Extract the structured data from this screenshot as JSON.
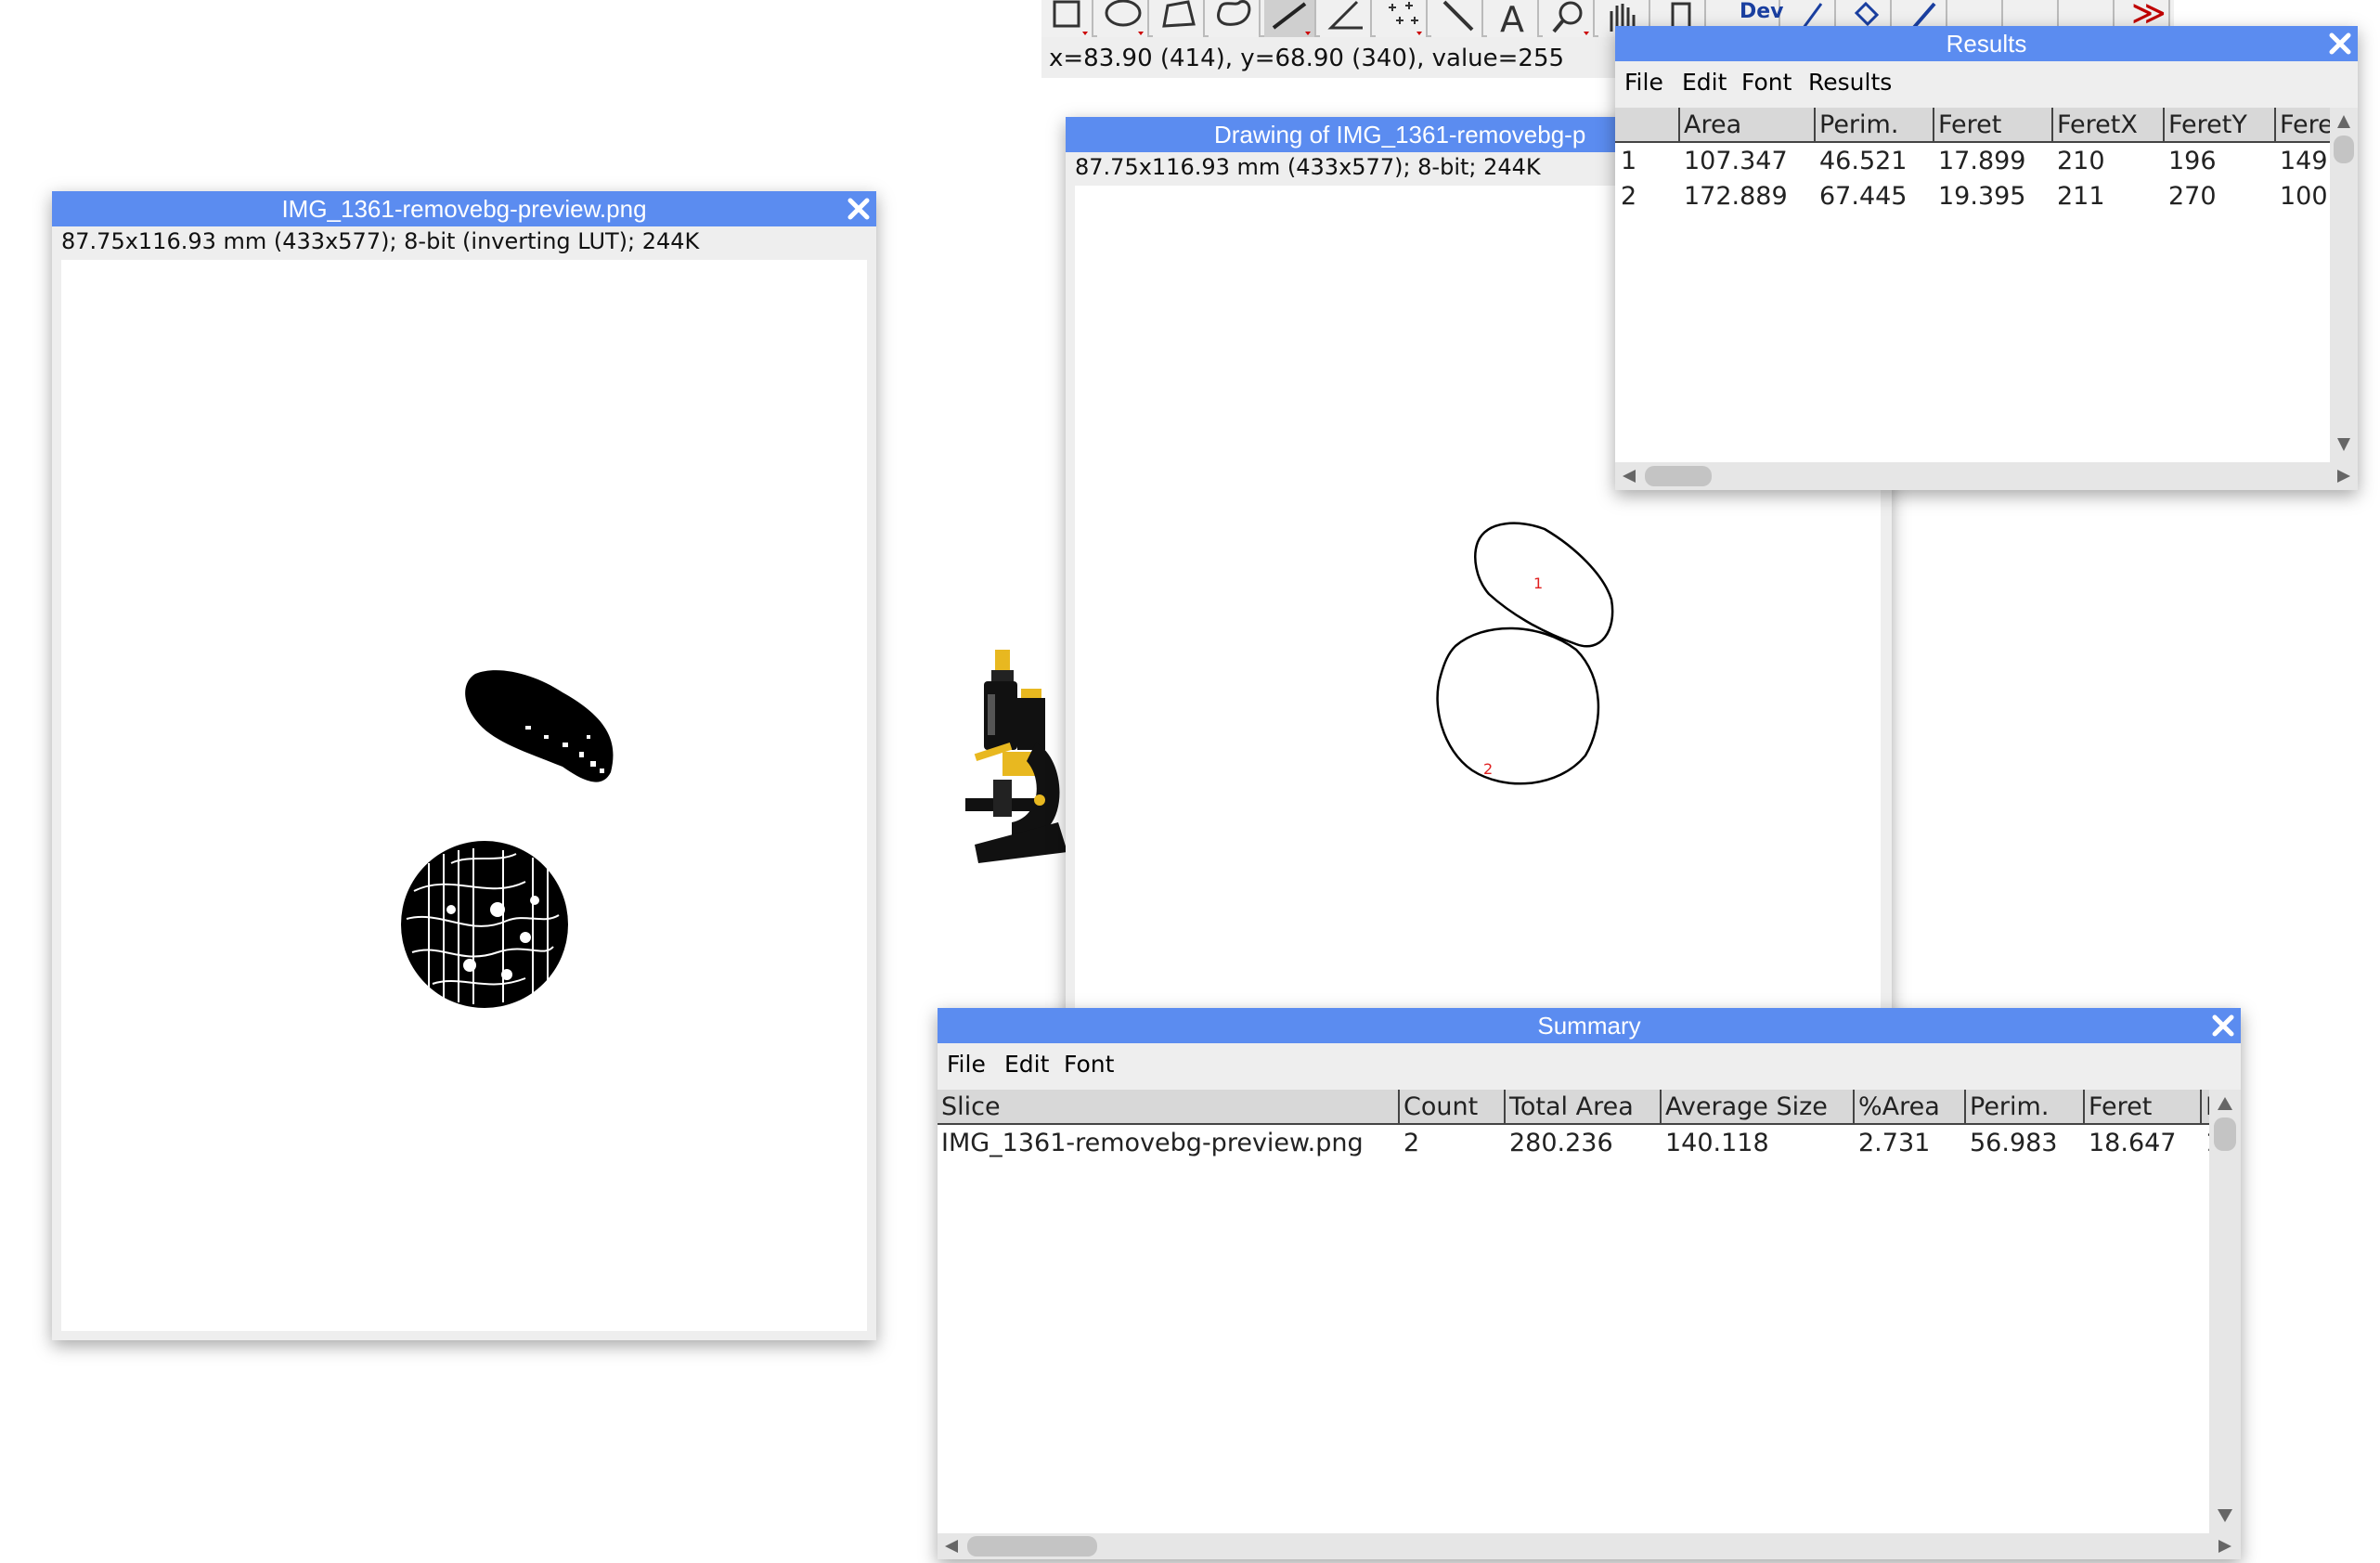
{
  "toolbar": {
    "coords": "x=83.90 (414), y=68.90 (340), value=255",
    "dev_label": "Dev",
    "more_label": "≫",
    "tools": [
      "rectangle-icon",
      "oval-icon",
      "polygon-icon",
      "freehand-icon",
      "line-icon",
      "angle-icon",
      "multipoint-icon",
      "wand-icon",
      "text-icon",
      "magnifier-icon",
      "hand-icon",
      "dropper-icon"
    ]
  },
  "image_window": {
    "title": "IMG_1361-removebg-preview.png",
    "info": "87.75x116.93 mm (433x577); 8-bit (inverting LUT); 244K"
  },
  "drawing_window": {
    "title": "Drawing of IMG_1361-removebg-p",
    "info": "87.75x116.93 mm (433x577); 8-bit; 244K",
    "labels": [
      "1",
      "2"
    ]
  },
  "results_window": {
    "title": "Results",
    "menu": [
      "File",
      "Edit",
      "Font",
      "Results"
    ],
    "columns": [
      "",
      "Area",
      "Perim.",
      "Feret",
      "FeretX",
      "FeretY",
      "Fere"
    ],
    "rows": [
      [
        "1",
        "107.347",
        "46.521",
        "17.899",
        "210",
        "196",
        "149"
      ],
      [
        "2",
        "172.889",
        "67.445",
        "19.395",
        "211",
        "270",
        "100"
      ]
    ]
  },
  "summary_window": {
    "title": "Summary",
    "menu": [
      "File",
      "Edit",
      "Font"
    ],
    "columns": [
      "Slice",
      "Count",
      "Total Area",
      "Average Size",
      "%Area",
      "Perim.",
      "Feret",
      "I"
    ],
    "rows": [
      [
        "IMG_1361-removebg-preview.png",
        "2",
        "280.236",
        "140.118",
        "2.731",
        "56.983",
        "18.647",
        "1"
      ]
    ]
  },
  "colors": {
    "titlebar": "#5b8cf0",
    "label_red": "#e02020"
  }
}
